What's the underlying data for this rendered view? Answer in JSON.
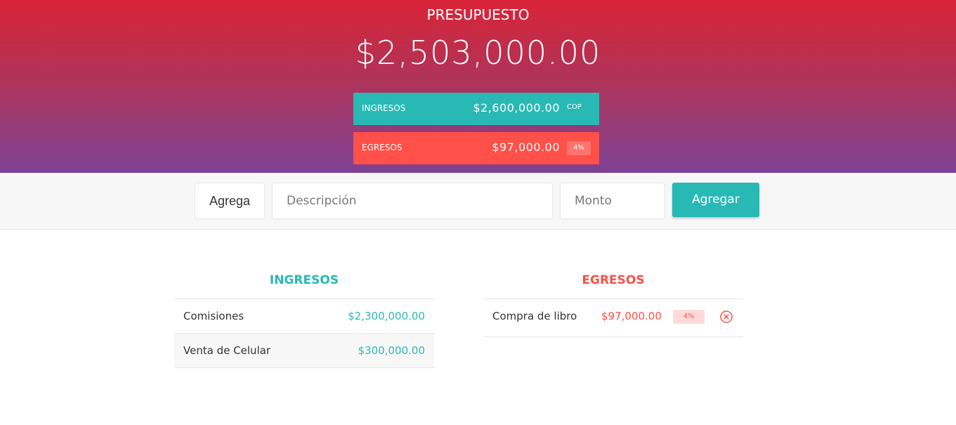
{
  "header": {
    "title": "PRESUPUESTO",
    "total": "$2,503,000.00",
    "income_summary": {
      "label": "INGRESOS",
      "value": "$2,600,000.00",
      "currency": "COP"
    },
    "expense_summary": {
      "label": "EGRESOS",
      "value": "$97,000.00",
      "percentage": "4%"
    }
  },
  "add_form": {
    "type_selected": "Agrega",
    "description_placeholder": "Descripción",
    "amount_placeholder": "Monto",
    "submit_label": "Agregar"
  },
  "income": {
    "title": "INGRESOS",
    "items": [
      {
        "description": "Comisiones",
        "value": "$2,300,000.00"
      },
      {
        "description": "Venta de Celular",
        "value": "$300,000.00"
      }
    ]
  },
  "expenses": {
    "title": "EGRESOS",
    "items": [
      {
        "description": "Compra de libro",
        "value": "$97,000.00",
        "percentage": "4%",
        "delete_icon": "close-circle-icon"
      }
    ]
  },
  "colors": {
    "income": "#28b9b5",
    "expense": "#ff5049",
    "header_gradient_top": "#d92437",
    "header_gradient_bottom": "#7d4294"
  }
}
